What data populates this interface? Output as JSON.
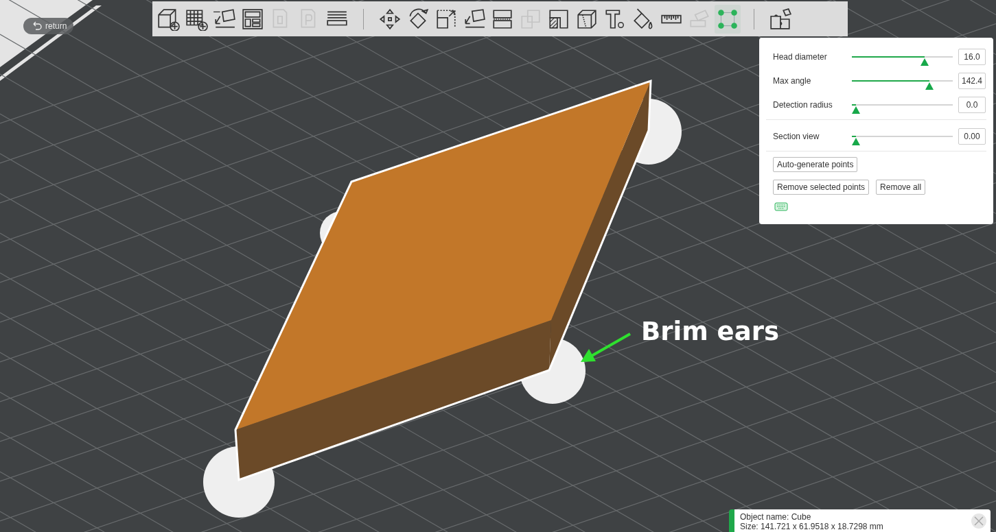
{
  "return_button": {
    "label": "return"
  },
  "toolbar": [
    {
      "disabled": false,
      "selected": false
    },
    {
      "disabled": false,
      "selected": false
    },
    {
      "disabled": false,
      "selected": false
    },
    {
      "disabled": false,
      "selected": false
    },
    {
      "disabled": true,
      "selected": false
    },
    {
      "disabled": true,
      "selected": false
    },
    {
      "disabled": false,
      "selected": false
    },
    {
      "disabled": false,
      "selected": false
    },
    {
      "disabled": false,
      "selected": false
    },
    {
      "disabled": false,
      "selected": false
    },
    {
      "disabled": false,
      "selected": false
    },
    {
      "disabled": false,
      "selected": false
    },
    {
      "disabled": true,
      "selected": false
    },
    {
      "disabled": false,
      "selected": false
    },
    {
      "disabled": false,
      "selected": false
    },
    {
      "disabled": false,
      "selected": false
    },
    {
      "disabled": false,
      "selected": false
    },
    {
      "disabled": false,
      "selected": false
    },
    {
      "disabled": true,
      "selected": false
    },
    {
      "disabled": false,
      "selected": true
    },
    {
      "disabled": false,
      "selected": false
    }
  ],
  "panel": {
    "slider_groups": [
      [
        {
          "label": "Head diameter",
          "level": 0.72,
          "value": "16.0"
        },
        {
          "label": "Max angle",
          "level": 0.77,
          "value": "142.4"
        },
        {
          "label": "Detection radius",
          "level": 0.04,
          "value": "0.0"
        }
      ],
      [
        {
          "label": "Section view",
          "level": 0.04,
          "value": "0.00"
        }
      ]
    ],
    "button_rows": [
      [
        "Auto-generate points"
      ],
      [
        "Remove selected points",
        "Remove all"
      ]
    ]
  },
  "annotation": {
    "text": "Brim ears"
  },
  "notification": {
    "lines": [
      "Object name: Cube",
      "Size: 141.721 x 61.9518 x 18.7298 mm"
    ]
  }
}
